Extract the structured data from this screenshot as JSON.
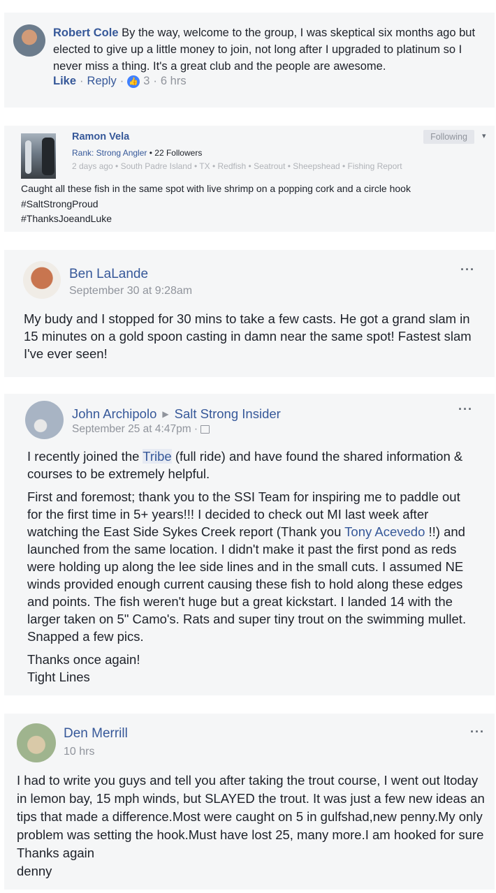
{
  "posts": [
    {
      "author": "Robert Cole",
      "text": "By the way, welcome to the group, I was skeptical six months ago but elected to give up a little money to join, not long after I upgraded to platinum so I never miss a thing. It's a great club and the people are awesome.",
      "like_label": "Like",
      "reply_label": "Reply",
      "sep": "·",
      "reactions": "3",
      "time": "6 hrs"
    },
    {
      "author": "Ramon Vela",
      "rank": "Rank: Strong Angler",
      "followers": "• 22 Followers",
      "tags": "2 days ago  • South Padre Island  • TX  • Redfish  • Seatrout  • Sheepshead  • Fishing Report",
      "follow_label": "Following",
      "caret": "▾",
      "lines": [
        "Caught all these fish in the same spot with live shrimp on a popping cork and a circle hook",
        "#SaltStrongProud",
        "#ThanksJoeandLuke"
      ]
    },
    {
      "author": "Ben LaLande",
      "date": "September 30 at 9:28am",
      "more": "···",
      "text": "My budy and I stopped for 30 mins to take a few casts. He got a grand slam in 15 minutes on a gold spoon casting in damn near the same spot! Fastest slam I've ever seen!"
    },
    {
      "author": "John Archipolo",
      "arrow": "▶",
      "group": "Salt Strong Insider",
      "date": "September 25 at 4:47pm ·",
      "more": "···",
      "p1_pre": "I recently joined the ",
      "p1_link": "Tribe",
      "p1_post": " (full ride) and have found the shared information & courses to be extremely helpful.",
      "p2_pre": "First and foremost; thank you to the SSI Team for inspiring me to paddle out for the first time in 5+ years!!! I decided to check out MI last week after watching the East Side Sykes Creek report (Thank you ",
      "p2_link": "Tony Acevedo",
      "p2_post": " !!) and launched from the same location. I didn't make it past the first pond as reds were holding up along the lee side lines and in the small cuts. I assumed NE winds provided enough current causing these fish to hold along these edges and points. The fish weren't huge but a great kickstart. I landed 14 with the larger taken on 5\" Camo's. Rats and super tiny trout on the swimming mullet. Snapped a few pics.",
      "p3a": "Thanks once again!",
      "p3b": "Tight Lines"
    },
    {
      "author": "Den Merrill",
      "date": "10 hrs",
      "more": "···",
      "text": "I had to write you guys and tell you after taking the trout course, I went out ltoday in lemon bay, 15 mph winds, but SLAYED the trout. It was just a few new ideas an tips that made a difference.Most were caught on 5 in gulfshad,new penny.My only problem was setting the hook.Must have lost 25, many more.I am hooked for sure Thanks again",
      "sign": "denny"
    }
  ]
}
